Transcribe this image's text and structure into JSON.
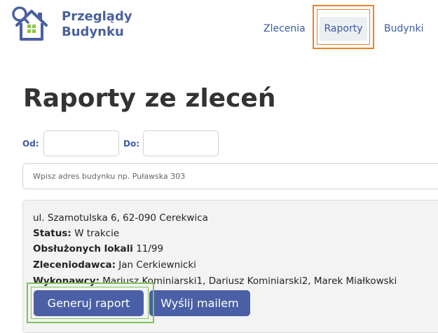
{
  "brand": {
    "line1": "Przeglądy",
    "line2": "Budynku"
  },
  "nav": {
    "zlecenia": "Zlecenia",
    "raporty": "Raporty",
    "budynki": "Budynki"
  },
  "page": {
    "title": "Raporty ze zleceń"
  },
  "filters": {
    "from_label": "Od:",
    "to_label": "Do:",
    "search_placeholder": "Wpisz adres budynku np. Puławska 303"
  },
  "report": {
    "address": "ul. Szamotulska 6, 62-090 Cerekwica",
    "status_label": "Status:",
    "status_value": " W trakcie",
    "units_label": "Obsłużonych lokali",
    "units_value": " 11/99",
    "client_label": "Zleceniodawca:",
    "client_value": " Jan Cerkiewnicki",
    "contractors_label": "Wykonawcy:",
    "contractors_value": " Mariusz Kominiarski1, Dariusz Kominiarski2, Marek Miałkowski"
  },
  "actions": {
    "generate_label": "Generuj raport",
    "email_label": "Wyślij mailem"
  },
  "colors": {
    "primary": "#4a5fa6",
    "nav_text": "#3c5aa6",
    "logo_green": "#8cc63f",
    "highlight_orange": "#e8822a",
    "highlight_green": "#7cc35a"
  }
}
